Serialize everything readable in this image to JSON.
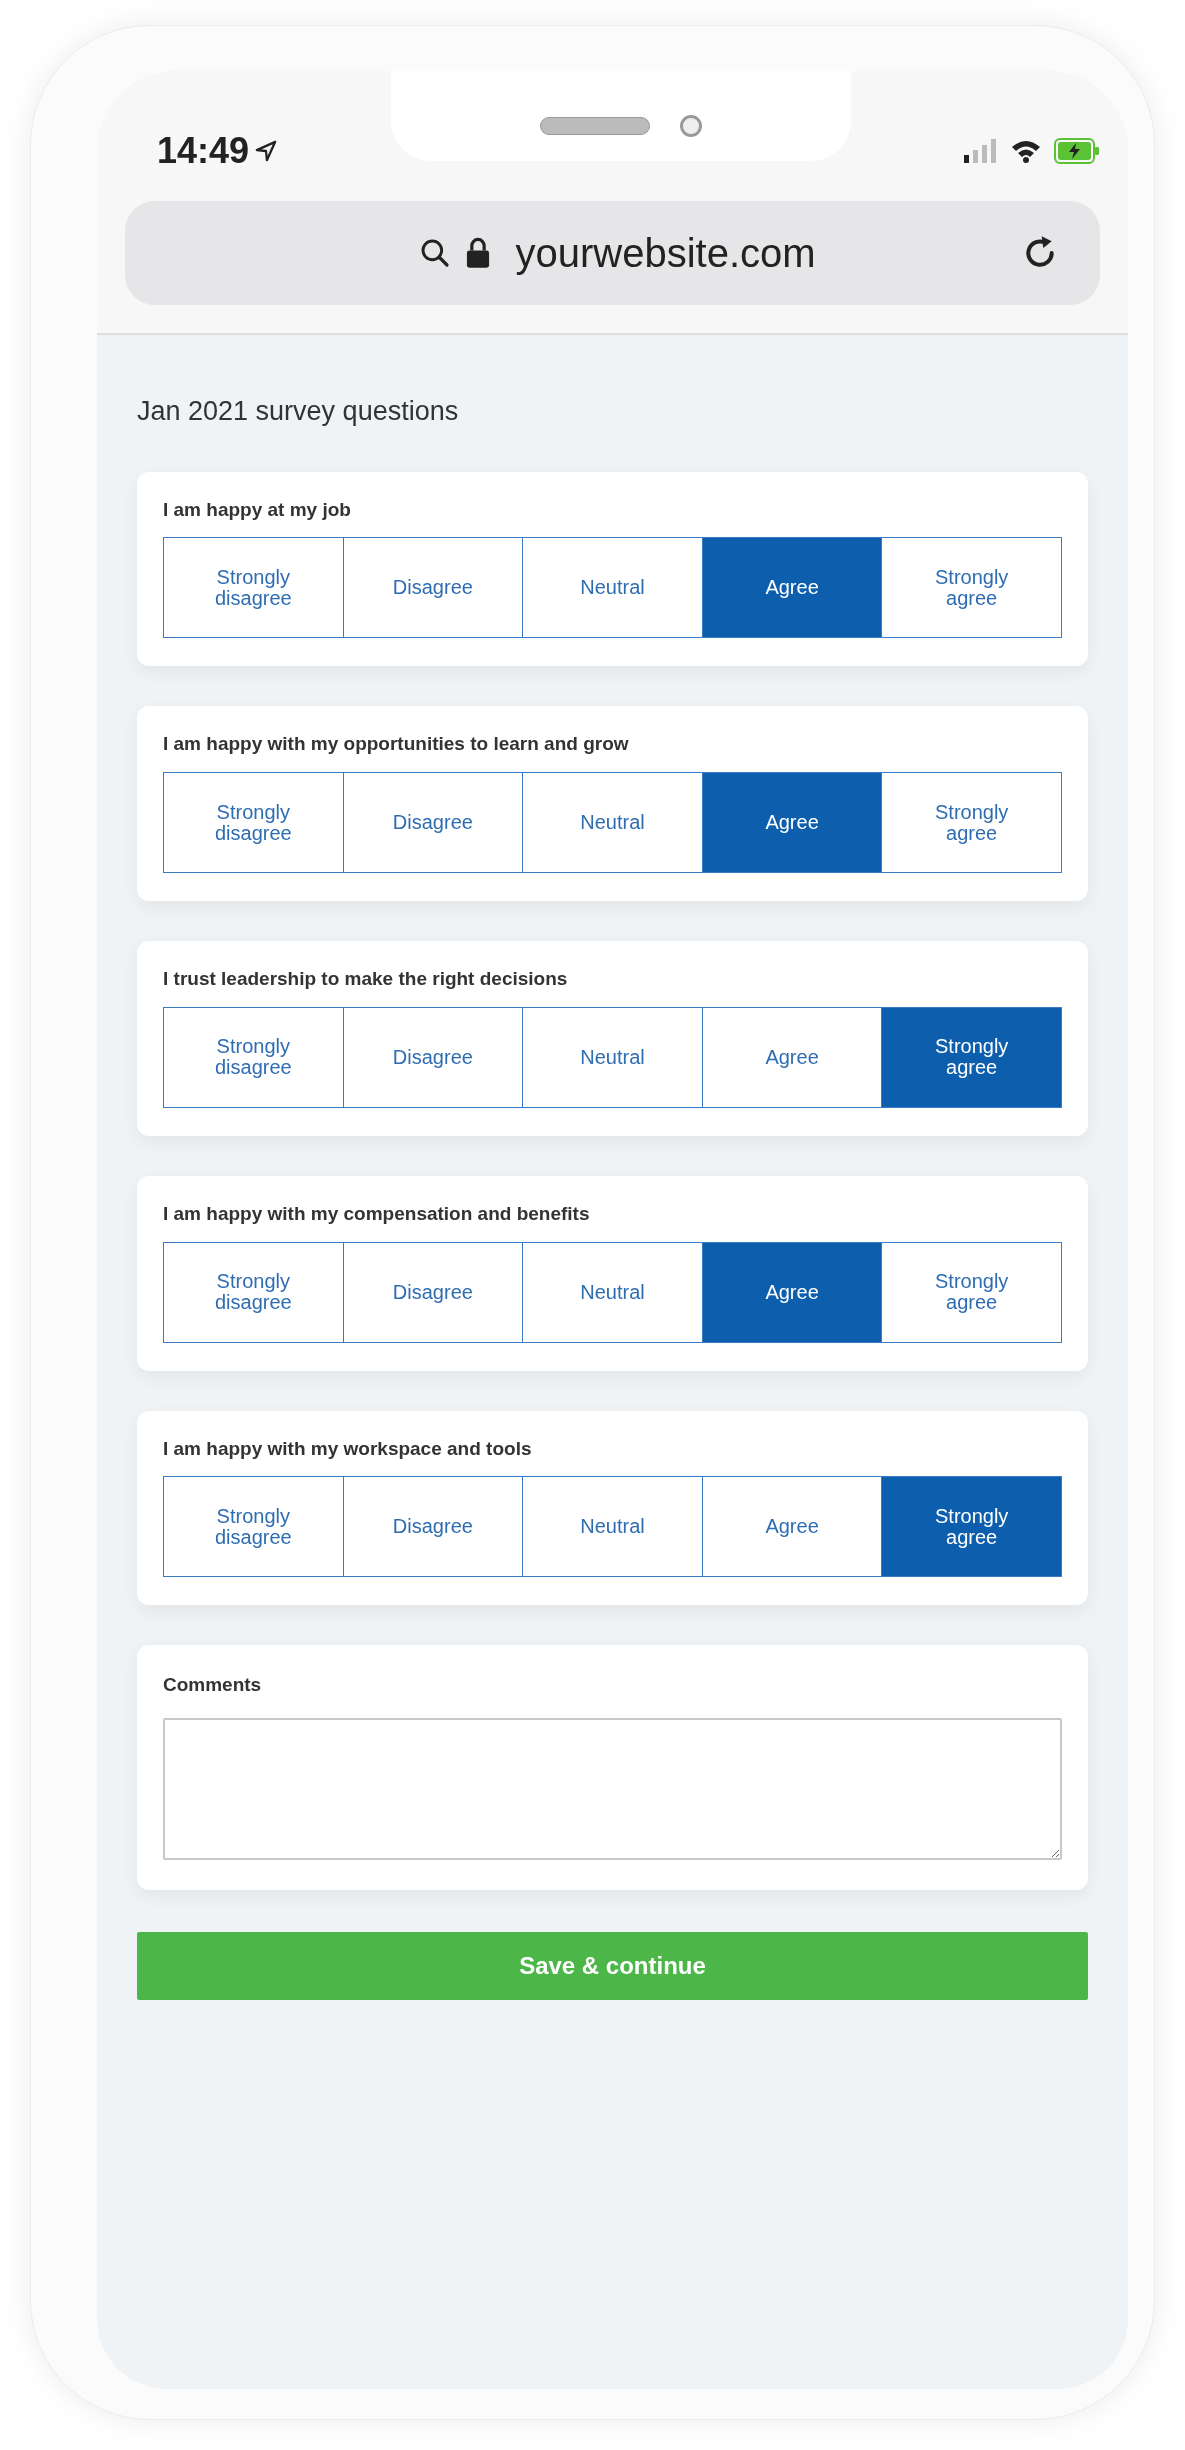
{
  "status_bar": {
    "time": "14:49"
  },
  "browser": {
    "url": "yourwebsite.com"
  },
  "page_title": "Jan 2021 survey questions",
  "questions": [
    {
      "text": "I am happy at my job",
      "options": [
        {
          "label": "Strongly disagree",
          "selected": false
        },
        {
          "label": "Disagree",
          "selected": false
        },
        {
          "label": "Neutral",
          "selected": false
        },
        {
          "label": "Agree",
          "selected": true
        },
        {
          "label": "Strongly agree",
          "selected": false
        }
      ]
    },
    {
      "text": "I am happy with my opportunities to learn and grow",
      "options": [
        {
          "label": "Strongly disagree",
          "selected": false
        },
        {
          "label": "Disagree",
          "selected": false
        },
        {
          "label": "Neutral",
          "selected": false
        },
        {
          "label": "Agree",
          "selected": true
        },
        {
          "label": "Strongly agree",
          "selected": false
        }
      ]
    },
    {
      "text": "I trust leadership to make the right decisions",
      "options": [
        {
          "label": "Strongly disagree",
          "selected": false
        },
        {
          "label": "Disagree",
          "selected": false
        },
        {
          "label": "Neutral",
          "selected": false
        },
        {
          "label": "Agree",
          "selected": false
        },
        {
          "label": "Strongly agree",
          "selected": true
        }
      ]
    },
    {
      "text": "I am happy with my compensation and benefits",
      "options": [
        {
          "label": "Strongly disagree",
          "selected": false
        },
        {
          "label": "Disagree",
          "selected": false
        },
        {
          "label": "Neutral",
          "selected": false
        },
        {
          "label": "Agree",
          "selected": true
        },
        {
          "label": "Strongly agree",
          "selected": false
        }
      ]
    },
    {
      "text": "I am happy with my workspace and tools",
      "options": [
        {
          "label": "Strongly disagree",
          "selected": false
        },
        {
          "label": "Disagree",
          "selected": false
        },
        {
          "label": "Neutral",
          "selected": false
        },
        {
          "label": "Agree",
          "selected": false
        },
        {
          "label": "Strongly agree",
          "selected": true
        }
      ]
    }
  ],
  "comments": {
    "label": "Comments"
  },
  "submit_button": "Save & continue"
}
